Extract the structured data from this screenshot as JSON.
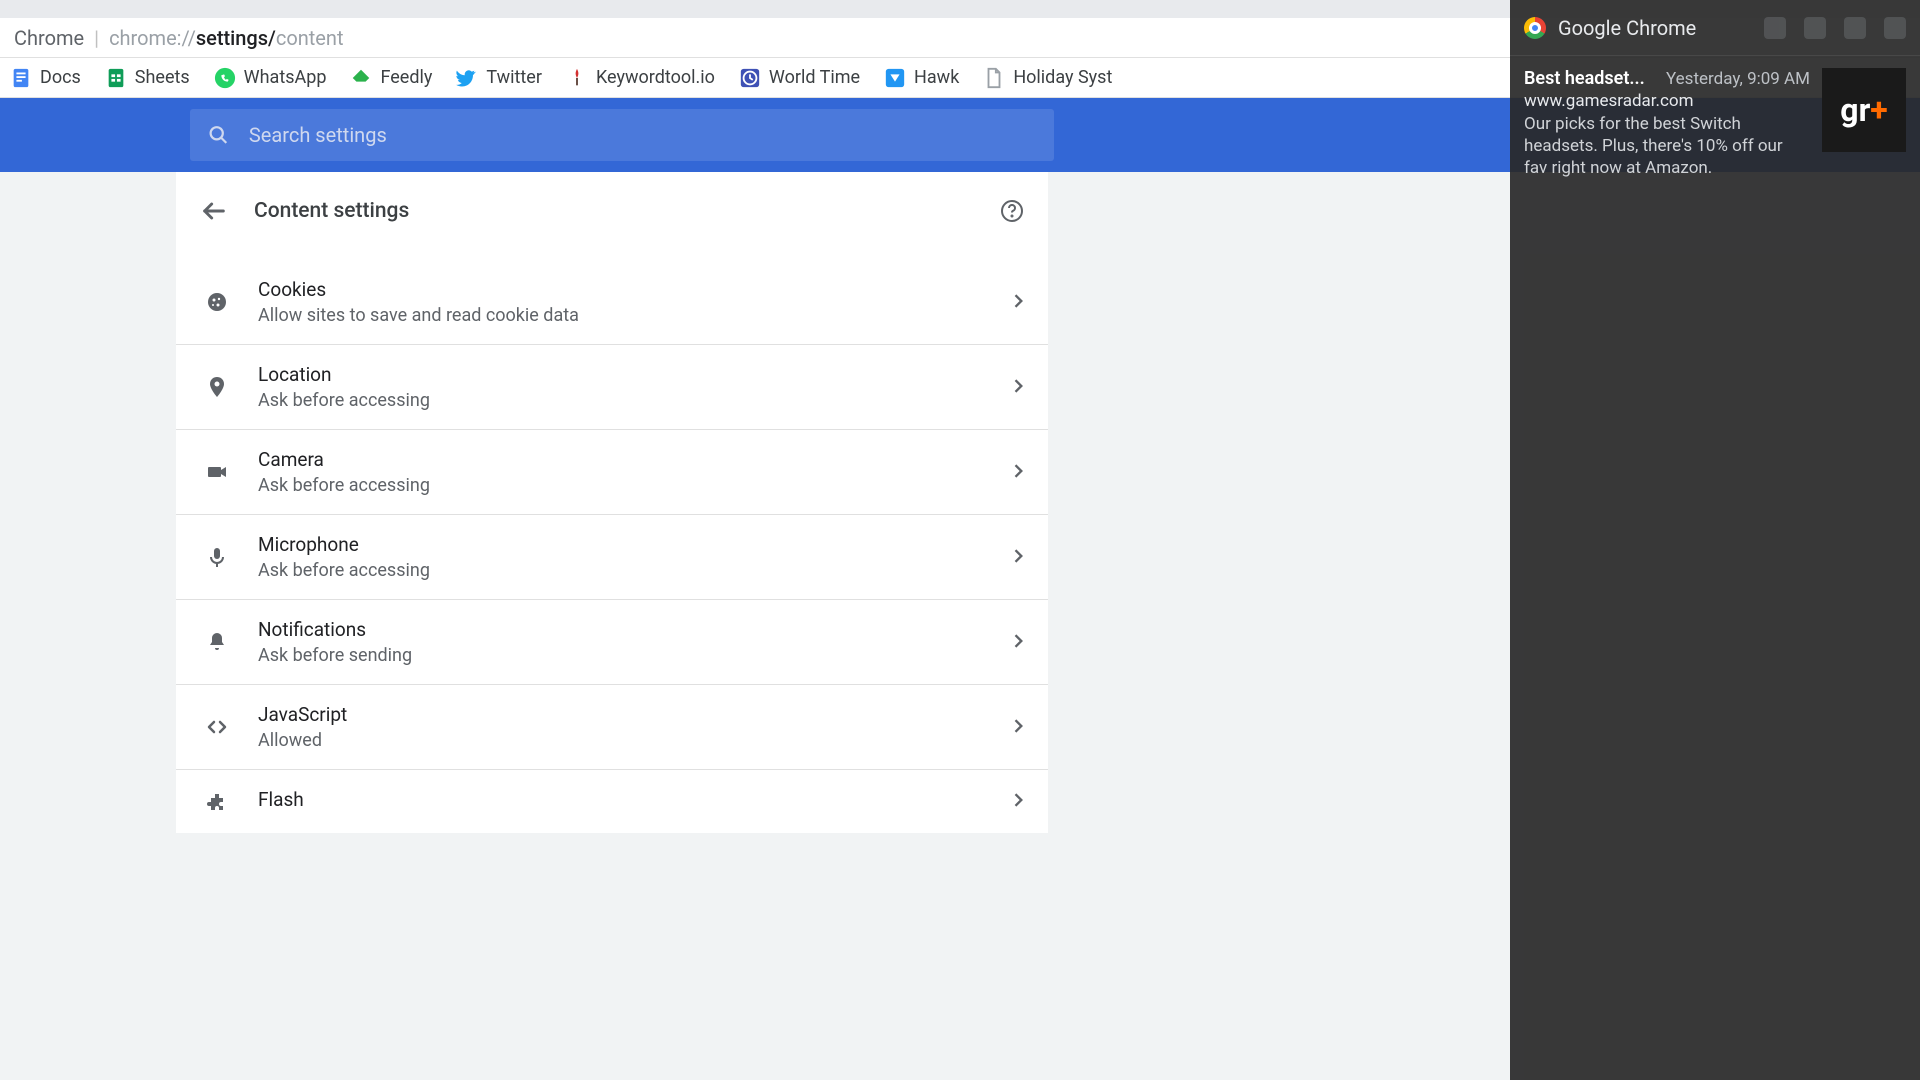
{
  "address": {
    "browser": "Chrome",
    "url_prefix": "chrome://",
    "url_bold": "settings/",
    "url_rest": "content"
  },
  "bookmarks": [
    {
      "label": "Docs",
      "icon": "docs-icon",
      "bg": "#4285f4"
    },
    {
      "label": "Sheets",
      "icon": "sheets-icon",
      "bg": "#0f9d58"
    },
    {
      "label": "WhatsApp",
      "icon": "whatsapp-icon",
      "bg": "#25d366"
    },
    {
      "label": "Feedly",
      "icon": "feedly-icon",
      "bg": "#2bb24c"
    },
    {
      "label": "Twitter",
      "icon": "twitter-icon",
      "bg": "#1da1f2"
    },
    {
      "label": "Keywordtool.io",
      "icon": "keyword-icon",
      "bg": "#ff5722"
    },
    {
      "label": "World Time",
      "icon": "clock-icon",
      "bg": "#3f51b5"
    },
    {
      "label": "Hawk",
      "icon": "hawk-icon",
      "bg": "#2196f3"
    },
    {
      "label": "Holiday Syst",
      "icon": "file-icon",
      "bg": "#ffffff"
    }
  ],
  "search": {
    "placeholder": "Search settings"
  },
  "section": {
    "title": "Content settings"
  },
  "settings": [
    {
      "icon": "cookie-icon",
      "title": "Cookies",
      "sub": "Allow sites to save and read cookie data"
    },
    {
      "icon": "location-icon",
      "title": "Location",
      "sub": "Ask before accessing"
    },
    {
      "icon": "camera-icon",
      "title": "Camera",
      "sub": "Ask before accessing"
    },
    {
      "icon": "microphone-icon",
      "title": "Microphone",
      "sub": "Ask before accessing"
    },
    {
      "icon": "bell-icon",
      "title": "Notifications",
      "sub": "Ask before sending"
    },
    {
      "icon": "code-icon",
      "title": "JavaScript",
      "sub": "Allowed"
    },
    {
      "icon": "plugin-icon",
      "title": "Flash",
      "sub": ""
    }
  ],
  "notification": {
    "app": "Google Chrome",
    "title": "Best headset...",
    "time": "Yesterday, 9:09 AM",
    "site": "www.gamesradar.com",
    "desc": "Our picks for the best Switch headsets. Plus, there's 10% off our fav right now at Amazon.",
    "thumb_text_a": "gr",
    "thumb_text_b": "+"
  }
}
